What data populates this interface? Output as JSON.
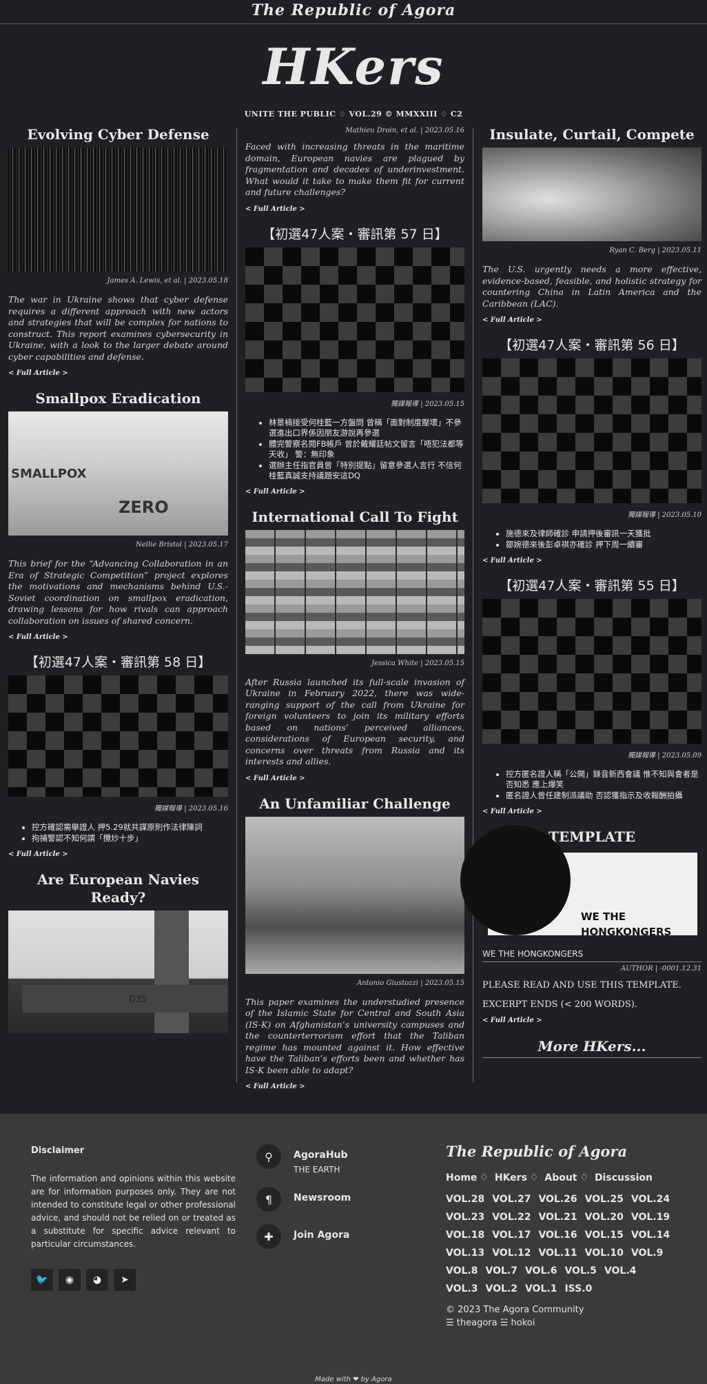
{
  "site": {
    "topbar_title": "The Republic of Agora",
    "logo": "HKers",
    "tagline": "UNITE THE PUBLIC ♢ VOL.29 © MMXXIII ♢ C2"
  },
  "full_article_label": "< Full Article >",
  "col1": [
    {
      "title": "Evolving Cyber Defense",
      "byline": "James A. Lewis, et al. | 2023.05.18",
      "summary": "The war in Ukraine shows that cyber defense requires a different approach with new actors and strategies that will be complex for nations to construct. This report examines cybersecurity in Ukraine, with a look to the larger debate around cyber capabilities and defense."
    },
    {
      "title": "Smallpox Eradication",
      "byline": "Nellie Bristol | 2023.05.17",
      "image_text_1": "SMALLPOX",
      "image_text_2": "ZERO",
      "summary": "This brief for the “Advancing Collaboration in an Era of Strategic Competition” project explores the motivations and mechanisms behind U.S.-Soviet coordination on smallpox eradication, drawing lessons for how rivals can approach collaboration on issues of shared concern."
    },
    {
      "title": "【初選47人案・審訊第 58 日】",
      "byline": "獨媒報導 | 2023.05.16",
      "bullets": [
        "控方確認需舉證人 押5.29就共謀原則作法律陳詞",
        "拘捕警認不知何謂「攬炒十步」"
      ]
    },
    {
      "title": "Are European Navies Ready?",
      "image_text": "D35"
    }
  ],
  "col2": [
    {
      "byline": "Mathieu Droin, et al. | 2023.05.16",
      "summary": "Faced with increasing threats in the maritime domain, European navies are plagued by fragmentation and decades of underinvestment. What would it take to make them fit for current and future challenges?"
    },
    {
      "title": "【初選47人案・審訊第 57 日】",
      "byline": "獨媒報導 | 2023.05.15",
      "bullets": [
        "林景楠接受何桂藍一方盤問 曾稱「面對制度壓壞」不參選進出口界係因朋友游說再參選",
        "體完警察名閱FB帳戶 曾於戴耀廷帖文留言「唔犯法都等天收」 警：無印象",
        "選辦主任指官員曾「特別提點」留意參選人言行 不信何桂藍真誠支持議題安這DQ"
      ]
    },
    {
      "title": "International Call To Fight",
      "byline": "Jessica White | 2023.05.15",
      "summary": "After Russia launched its full-scale invasion of Ukraine in February 2022, there was wide-ranging support of the call from Ukraine for foreign volunteers to join its military efforts based on nations’ perceived alliances, considerations of European security, and concerns over threats from Russia and its interests and allies."
    },
    {
      "title": "An Unfamiliar Challenge",
      "byline": "Antonio Giustozzi | 2023.05.15",
      "summary": "This paper examines the understudied presence of the Islamic State for Central and South Asia (IS-K) on Afghanistan’s university campuses and the counterterrorism effort that the Taliban regime has mounted against it. How effective have the Taliban’s efforts been and whether has IS-K been able to adapt?"
    }
  ],
  "col3": [
    {
      "title": "Insulate, Curtail, Compete",
      "byline": "Ryan C. Berg | 2023.05.11",
      "summary": "The U.S. urgently needs a more effective, evidence-based, feasible, and holistic strategy for countering China in Latin America and the Caribbean (LAC)."
    },
    {
      "title": "【初選47人案・審訊第 56 日】",
      "byline": "獨媒報導 | 2023.05.10",
      "bullets": [
        "施德來及律師確診 申請押後審訊一天獲批",
        "鄒婉德來後彭卓祺亦確診 押下周一續審"
      ]
    },
    {
      "title": "【初選47人案・審訊第 55 日】",
      "byline": "獨媒報導 | 2023.05.09",
      "bullets": [
        "控方匿名證人稱「公開」錄音新西會議 惟不知與會者是否知悉 應上爆笑",
        "匿名證人曾任建制派議助 否認獲指示及收報酬拍攝"
      ]
    },
    {
      "title": "TEMPLATE",
      "image_text": "WE THE HONGKONGERS",
      "label": "WE THE HONGKONGERS",
      "byline": "AUTHOR | -0001.12.31",
      "body_1": "PLEASE READ AND USE THIS TEMPLATE.",
      "body_2": "EXCERPT ENDS (< 200 WORDS)."
    },
    {
      "more": "More HKers..."
    }
  ],
  "footer": {
    "disclaimer_title": "Disclaimer",
    "disclaimer_text": "The information and opinions within this website are for information purposes only. They are not intended to constitute legal or other professional advice, and should not be relied on or treated as a substitute for specific advice relevant to particular circumstances.",
    "social_icons": [
      "twitter-icon",
      "github-icon",
      "reddit-icon",
      "telegram-icon"
    ],
    "menu": [
      {
        "icon": "map-pin-icon",
        "title": "AgoraHub",
        "sub": "THE EARTH"
      },
      {
        "icon": "pilcrow-icon",
        "title": "Newsroom"
      },
      {
        "icon": "puzzle-icon",
        "title": "Join Agora"
      }
    ],
    "brand": "The Republic of Agora",
    "nav": [
      "Home",
      "HKers",
      "About",
      "Discussion"
    ],
    "vols": [
      "VOL.28",
      "VOL.27",
      "VOL.26",
      "VOL.25",
      "VOL.24",
      "VOL.23",
      "VOL.22",
      "VOL.21",
      "VOL.20",
      "VOL.19",
      "VOL.18",
      "VOL.17",
      "VOL.16",
      "VOL.15",
      "VOL.14",
      "VOL.13",
      "VOL.12",
      "VOL.11",
      "VOL.10",
      "VOL.9",
      "VOL.8",
      "VOL.7",
      "VOL.6",
      "VOL.5",
      "VOL.4",
      "VOL.3",
      "VOL.2",
      "VOL.1",
      "ISS.0"
    ],
    "copyright": "© 2023 The Agora Community",
    "handles": "☰ theagora ☱ hokoi",
    "made_with": "Made with ❤ by Agora"
  }
}
